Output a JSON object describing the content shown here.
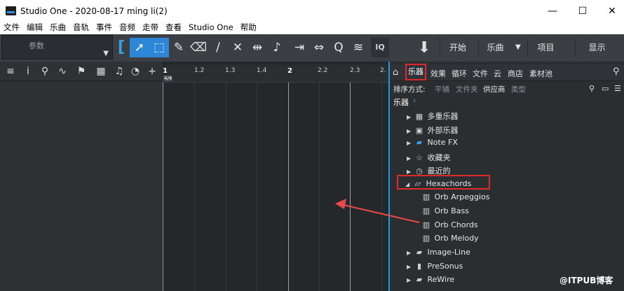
{
  "window": {
    "title": "Studio One - 2020-08-17 ming li(2)",
    "controls": [
      "—",
      "☐",
      "✕"
    ]
  },
  "menu": [
    "文件",
    "编辑",
    "乐曲",
    "音轨",
    "事件",
    "音频",
    "走带",
    "查看",
    "Studio One",
    "帮助"
  ],
  "toolbar": {
    "param_label": "参数",
    "iq_label": "IQ",
    "nav": [
      "开始",
      "乐曲",
      "项目",
      "显示"
    ]
  },
  "ruler": {
    "ticks": [
      "1",
      "1.2",
      "1.3",
      "1.4",
      "2",
      "2.2",
      "2.3",
      "2."
    ],
    "signature": "4/4"
  },
  "browser": {
    "tabs": [
      "乐器",
      "效果",
      "循环",
      "文件",
      "云",
      "商店",
      "素材池"
    ],
    "sort_label": "排序方式:",
    "sort_options": [
      "平铺",
      "文件夹",
      "供应商",
      "类型"
    ],
    "sort_active": "供应商",
    "breadcrumb": "乐器",
    "items": [
      {
        "label": "多重乐器",
        "icon": "multi-instrument-icon",
        "level": 1
      },
      {
        "label": "外部乐器",
        "icon": "external-instrument-icon",
        "level": 1
      },
      {
        "label": "Note FX",
        "icon": "folder-icon",
        "level": 1
      },
      {
        "label": "收藏夹",
        "icon": "star-icon",
        "level": 1
      },
      {
        "label": "最近的",
        "icon": "clock-icon",
        "level": 1
      },
      {
        "label": "Hexachords",
        "icon": "folder-open-icon",
        "level": 1,
        "expanded": true
      },
      {
        "label": "Orb Arpeggios",
        "icon": "keyboard-icon",
        "level": 2
      },
      {
        "label": "Orb Bass",
        "icon": "keyboard-icon",
        "level": 2
      },
      {
        "label": "Orb Chords",
        "icon": "keyboard-icon",
        "level": 2
      },
      {
        "label": "Orb Melody",
        "icon": "keyboard-icon",
        "level": 2
      },
      {
        "label": "Image-Line",
        "icon": "folder-icon",
        "level": 1
      },
      {
        "label": "PreSonus",
        "icon": "presonus-icon",
        "level": 1
      },
      {
        "label": "ReWire",
        "icon": "folder-icon",
        "level": 1
      }
    ]
  },
  "watermark": "@ITPUB博客",
  "colors": {
    "accent": "#2d87d6",
    "highlight": "#e02a2a"
  }
}
